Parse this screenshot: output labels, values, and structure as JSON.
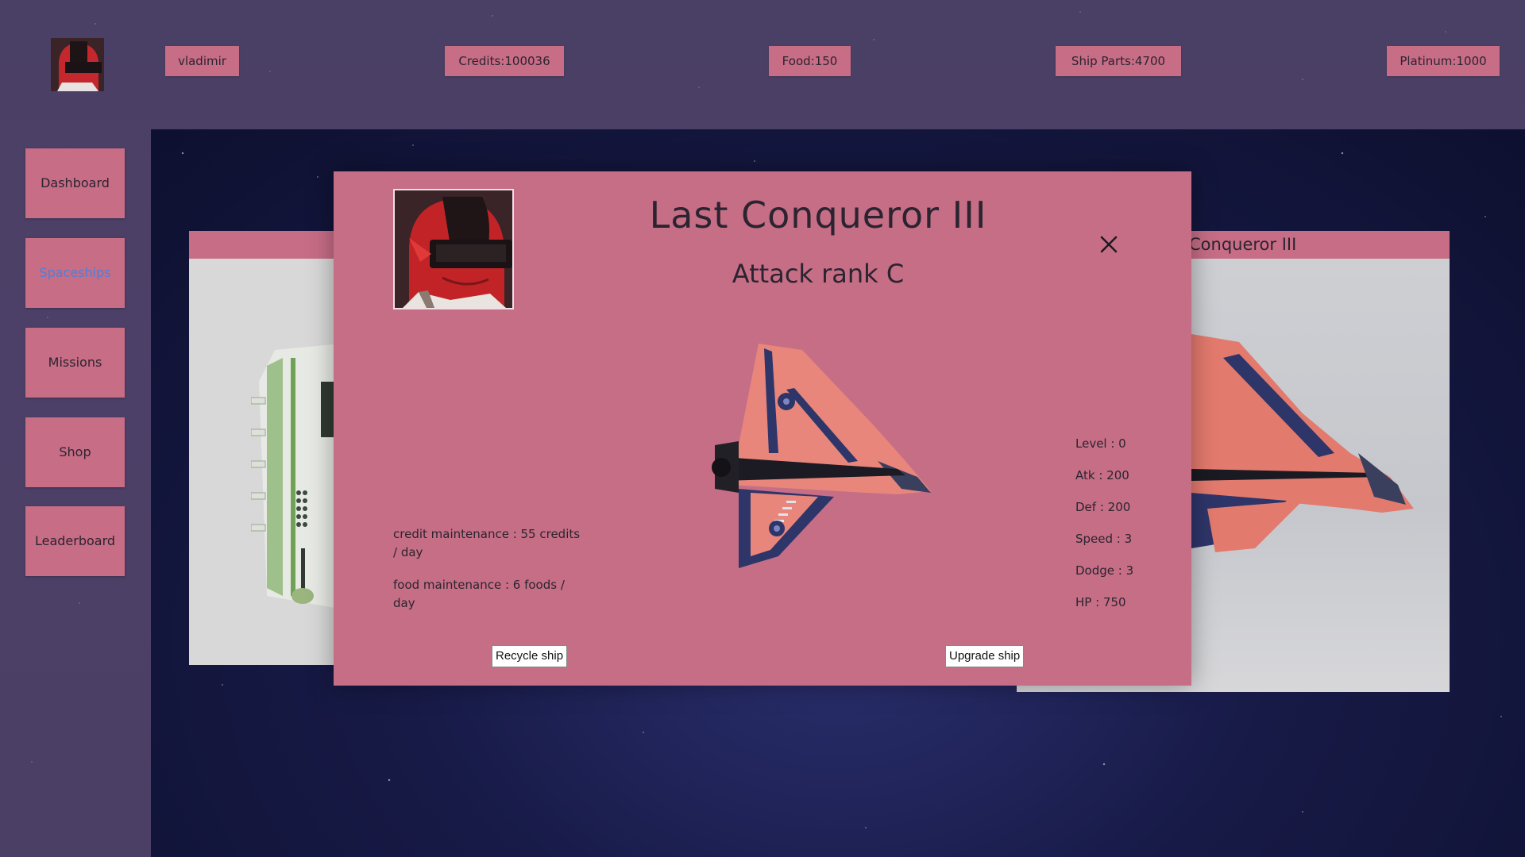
{
  "header": {
    "username": "vladimir",
    "credits": "Credits:100036",
    "food": "Food:150",
    "ship_parts": "Ship Parts:4700",
    "platinum": "Platinum:1000"
  },
  "sidebar": {
    "items": [
      {
        "label": "Dashboard"
      },
      {
        "label": "Spaceships"
      },
      {
        "label": "Missions"
      },
      {
        "label": "Shop"
      },
      {
        "label": "Leaderboard"
      }
    ],
    "active": "Spaceships"
  },
  "background_cards": {
    "right_title": "Conqueror III"
  },
  "modal": {
    "title": "Last Conqueror III",
    "subtitle": "Attack rank C",
    "credit_maintenance": "credit maintenance : 55 credits / day",
    "food_maintenance": "food maintenance : 6 foods / day",
    "stats": {
      "level": "Level : 0",
      "atk": "Atk : 200",
      "def": "Def : 200",
      "speed": "Speed : 3",
      "dodge": "Dodge : 3",
      "hp": "HP : 750"
    },
    "recycle_label": "Recycle ship",
    "upgrade_label": "Upgrade ship"
  },
  "colors": {
    "accent": "#c76d86",
    "active_nav": "#4f7fd8",
    "sidebar_bg": "#4b3f66"
  }
}
